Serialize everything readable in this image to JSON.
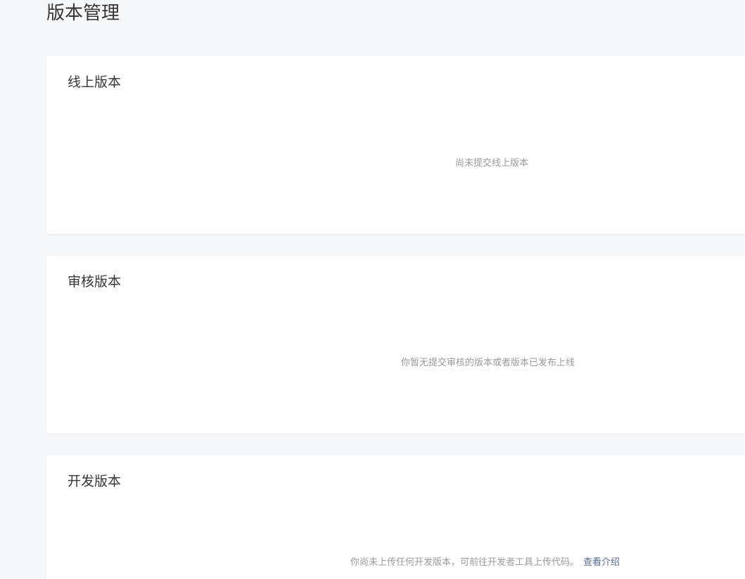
{
  "page": {
    "title": "版本管理"
  },
  "sections": {
    "online": {
      "title": "线上版本",
      "empty_text": "尚未提交线上版本"
    },
    "review": {
      "title": "审核版本",
      "empty_text": "你暂无提交审核的版本或者版本已发布上线"
    },
    "develop": {
      "title": "开发版本",
      "empty_text": "你尚未上传任何开发版本，可前往开发者工具上传代码。",
      "link_label": "查看介绍"
    }
  },
  "colors": {
    "background": "#f6f7f9",
    "card": "#ffffff",
    "text": "#353535",
    "muted": "#9a9a9a",
    "link": "#576b95"
  }
}
